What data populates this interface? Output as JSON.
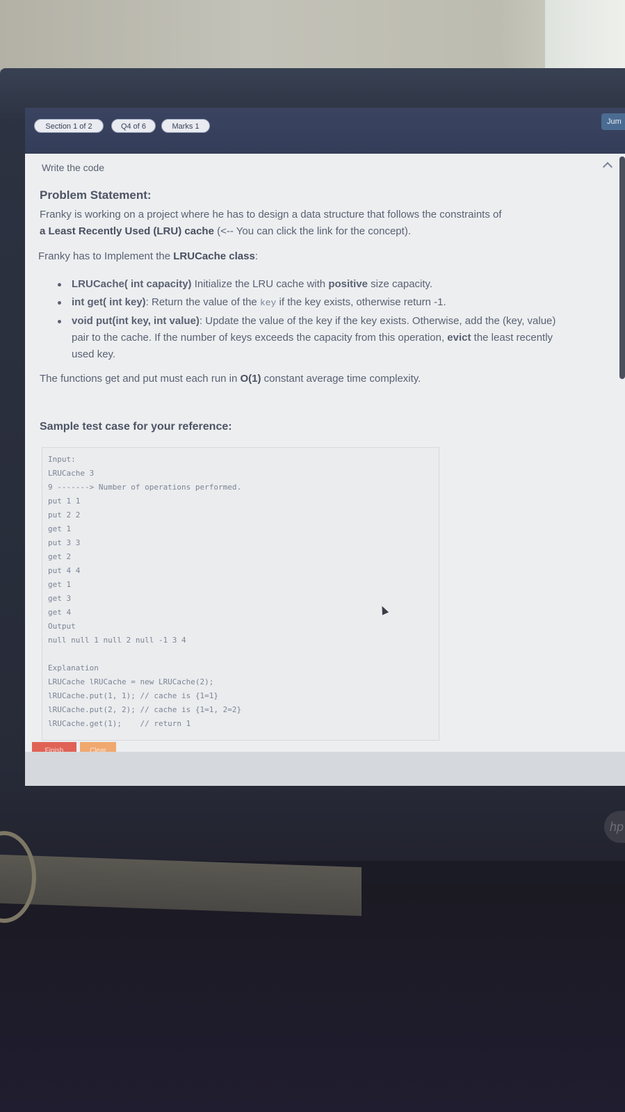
{
  "header": {
    "section_pill": "Section 1 of 2",
    "question_pill": "Q4 of 6",
    "marks_pill": "Marks 1",
    "jump_label": "Jum"
  },
  "content": {
    "section_title": "Write the code",
    "problem_heading": "Problem Statement:",
    "intro_line1": "Franky is working on a project where he has to design a data structure that follows the constraints of",
    "intro_line2_bold": "a Least Recently Used (LRU) cache",
    "intro_line2_rest": " (<-- You can click the link for the concept).",
    "implement_text": "Franky has to Implement the ",
    "implement_bold": "LRUCache class",
    "implement_colon": ":",
    "bullets": [
      {
        "bold": "LRUCache( int capacity)",
        "text1": " Initialize the LRU cache with ",
        "bold2": "positive",
        "text2": " size capacity."
      },
      {
        "bold": "int get( int key)",
        "text1": ": Return the value of the ",
        "code": "key",
        "text2": " if the key exists, otherwise return -1."
      },
      {
        "bold": "void put(int key, int value)",
        "text1": ": Update the value of the key if the key exists. Otherwise, add the (key, value) pair to the cache. If the number of keys exceeds the capacity from this operation, ",
        "bold2": "evict",
        "text2": " the least recently used key."
      }
    ],
    "complexity_text1": "The functions get and put must each run in ",
    "complexity_bold": "O(1)",
    "complexity_text2": " constant average time complexity.",
    "sample_heading": "Sample test case for your reference:",
    "code_lines": [
      "Input:",
      "LRUCache 3",
      "9 -------> Number of operations performed.",
      "put 1 1",
      "put 2 2",
      "get 1",
      "put 3 3",
      "get 2",
      "put 4 4",
      "get 1",
      "get 3",
      "get 4",
      "Output",
      "null null 1 null 2 null -1 3 4",
      "",
      "Explanation",
      "LRUCache lRUCache = new LRUCache(2);",
      "lRUCache.put(1, 1); // cache is {1=1}",
      "lRUCache.put(2, 2); // cache is {1=1, 2=2}",
      "lRUCache.get(1);    // return 1"
    ]
  },
  "buttons": {
    "finish": "Finish",
    "clear": "Clear"
  },
  "hp_logo": "hp"
}
